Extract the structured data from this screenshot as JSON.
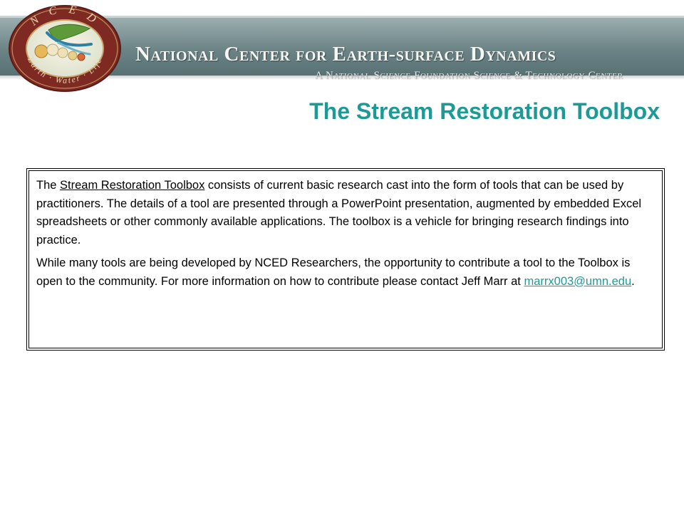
{
  "header": {
    "logo_text_top": "N C E D",
    "logo_text_bottom": "Earth · Water · Life",
    "title": "National Center for Earth-surface Dynamics",
    "subtitle": "A National Science Foundation Science & Technology Center"
  },
  "page": {
    "title": "The Stream Restoration Toolbox"
  },
  "content": {
    "p1_prefix": "The ",
    "p1_link": "Stream Restoration Toolbox",
    "p1_rest": " consists of current basic research cast into the form of tools that can be used by practitioners. The details of a tool are presented through a PowerPoint presentation, augmented by embedded Excel spreadsheets or other commonly available applications. The toolbox is a vehicle for bringing research findings into practice.",
    "p2_text": "While many tools are being developed by NCED Researchers, the opportunity to contribute a tool to the Toolbox is open to the community. For more information on how to contribute please contact Jeff Marr at ",
    "p2_email": "marrx003@umn.edu",
    "p2_end": "."
  },
  "colors": {
    "accent_teal": "#1e9a96",
    "banner": "#6a8285",
    "logo_ring": "#8a2a22"
  }
}
